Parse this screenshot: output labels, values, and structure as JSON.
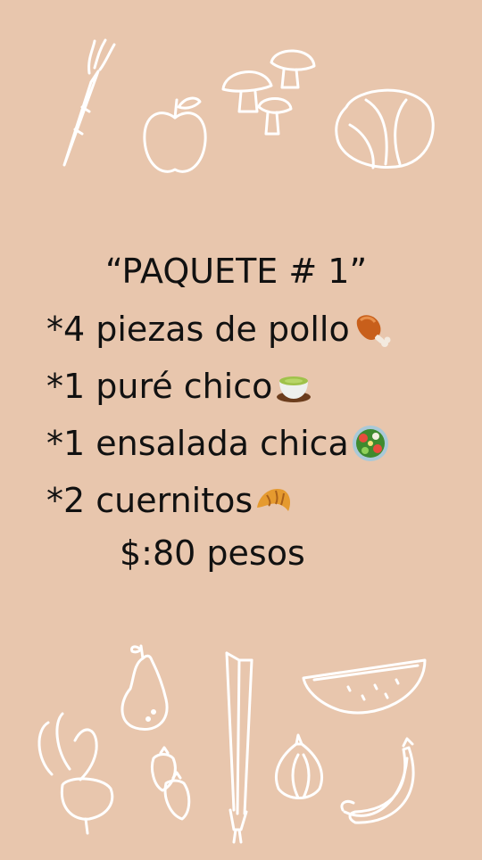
{
  "title": "“PAQUETE # 1”",
  "items": [
    {
      "text": "*4 piezas de pollo",
      "emoji": "poultry-leg-emoji"
    },
    {
      "text": "*1 puré chico",
      "emoji": "soup-bowl-emoji"
    },
    {
      "text": "*1 ensalada chica",
      "emoji": "salad-emoji"
    },
    {
      "text": "*2 cuernitos",
      "emoji": "croissant-emoji"
    }
  ],
  "price": "$:80 pesos",
  "colors": {
    "background": "#e8c6ad",
    "text": "#111111",
    "line_art": "#ffffff"
  }
}
